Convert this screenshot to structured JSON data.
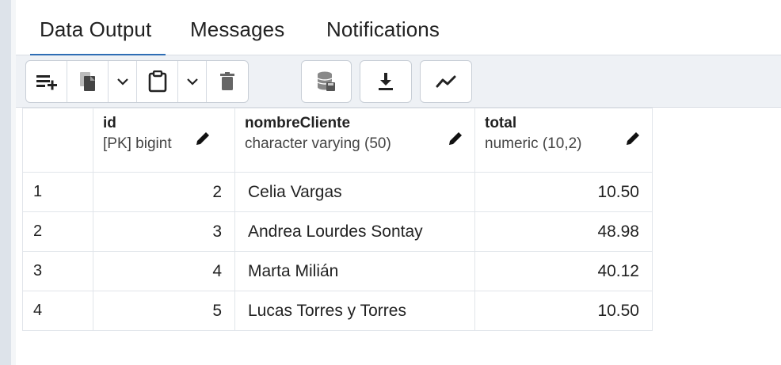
{
  "tabs": [
    {
      "label": "Data Output",
      "active": true
    },
    {
      "label": "Messages",
      "active": false
    },
    {
      "label": "Notifications",
      "active": false
    }
  ],
  "toolbar": {
    "icons": [
      "add-row-icon",
      "copy-icon",
      "chevron-down-icon",
      "paste-icon",
      "chevron-down-icon",
      "delete-icon",
      "save-data-icon",
      "download-icon",
      "graph-visualiser-icon"
    ]
  },
  "grid": {
    "columns": [
      {
        "name": "id",
        "type": "[PK] bigint"
      },
      {
        "name": "nombreCliente",
        "type": "character varying (50)"
      },
      {
        "name": "total",
        "type": "numeric (10,2)"
      }
    ],
    "rows": [
      {
        "num": "1",
        "id": "2",
        "nombreCliente": "Celia Vargas",
        "total": "10.50"
      },
      {
        "num": "2",
        "id": "3",
        "nombreCliente": "Andrea Lourdes Sontay",
        "total": "48.98"
      },
      {
        "num": "3",
        "id": "4",
        "nombreCliente": "Marta Milián",
        "total": "40.12"
      },
      {
        "num": "4",
        "id": "5",
        "nombreCliente": "Lucas Torres y Torres",
        "total": "10.50"
      }
    ]
  },
  "colors": {
    "accent": "#2e6db4",
    "toolbar_bg": "#eef1f5"
  }
}
